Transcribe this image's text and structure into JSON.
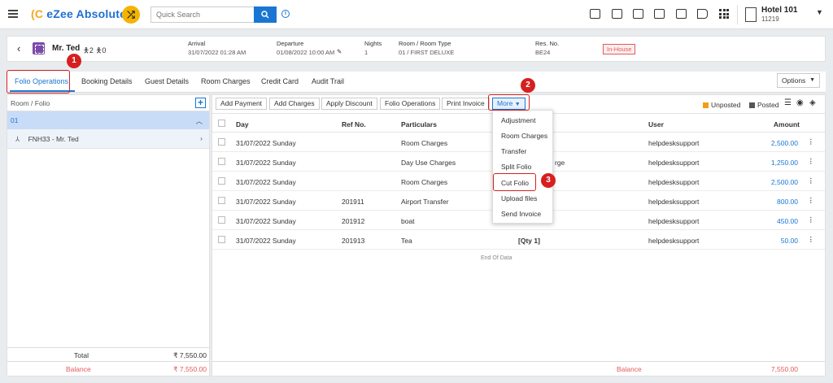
{
  "app": {
    "logo_icon": "(C",
    "logo_text": "eZee Absolute",
    "shuffle_glyph": "⤮",
    "info_glyph": "i"
  },
  "search": {
    "placeholder": "Quick Search"
  },
  "hotel": {
    "name": "Hotel 101",
    "id": "11219"
  },
  "guest": {
    "name": "Mr. Ted",
    "pax": "2",
    "children": "0",
    "arrival_label": "Arrival",
    "arrival_value": "31/07/2022 01:28 AM",
    "departure_label": "Departure",
    "departure_value": "01/08/2022 10:00 AM",
    "nights_label": "Nights",
    "nights_value": "1",
    "room_label": "Room / Room Type",
    "room_value": "01 / FIRST DELUXE",
    "resno_label": "Res. No.",
    "resno_value": "BE24",
    "status": "In-House"
  },
  "tabs": [
    "Folio Operations",
    "Booking Details",
    "Guest Details",
    "Room Charges",
    "Credit Card",
    "Audit Trail"
  ],
  "options_label": "Options",
  "left_panel": {
    "header": "Room / Folio",
    "folio_room": "01",
    "folio_sub": "FNH33 - Mr. Ted",
    "total_label": "Total",
    "total_value": "₹ 7,550.00",
    "balance_label": "Balance",
    "balance_value": "₹ 7,550.00"
  },
  "toolbar": {
    "add_payment": "Add Payment",
    "add_charges": "Add Charges",
    "apply_discount": "Apply Discount",
    "folio_operations": "Folio Operations",
    "print_invoice": "Print Invoice",
    "more": "More"
  },
  "legend": {
    "unposted": "Unposted",
    "posted": "Posted",
    "unposted_color": "#f39c12",
    "posted_color": "#555555"
  },
  "table": {
    "columns": {
      "day": "Day",
      "ref": "Ref No.",
      "particulars": "Particulars",
      "user": "User",
      "amount": "Amount"
    },
    "rows": [
      {
        "day": "31/07/2022 Sunday",
        "ref": "",
        "particulars": "Room Charges",
        "extra": "",
        "user": "helpdesksupport",
        "amount": "2,500.00"
      },
      {
        "day": "31/07/2022 Sunday",
        "ref": "",
        "particulars": "Day Use Charges",
        "extra": "rge",
        "user": "helpdesksupport",
        "amount": "1,250.00"
      },
      {
        "day": "31/07/2022 Sunday",
        "ref": "",
        "particulars": "Room Charges",
        "extra": "",
        "user": "helpdesksupport",
        "amount": "2,500.00"
      },
      {
        "day": "31/07/2022 Sunday",
        "ref": "201911",
        "particulars": "Airport Transfer",
        "extra": "",
        "user": "helpdesksupport",
        "amount": "800.00"
      },
      {
        "day": "31/07/2022 Sunday",
        "ref": "201912",
        "particulars": "boat",
        "extra": "",
        "user": "helpdesksupport",
        "amount": "450.00"
      },
      {
        "day": "31/07/2022 Sunday",
        "ref": "201913",
        "particulars": "Tea",
        "extra": "[Qty 1]",
        "user": "helpdesksupport",
        "amount": "50.00"
      }
    ],
    "end_text": "End Of Data",
    "balance_label": "Balance",
    "balance_value": "7,550.00"
  },
  "more_menu": [
    "Adjustment",
    "Room Charges",
    "Transfer",
    "Split Folio",
    "Cut Folio",
    "Upload files",
    "Send Invoice"
  ],
  "markers": [
    "1",
    "2",
    "3"
  ],
  "annotation_color": "#d62020"
}
